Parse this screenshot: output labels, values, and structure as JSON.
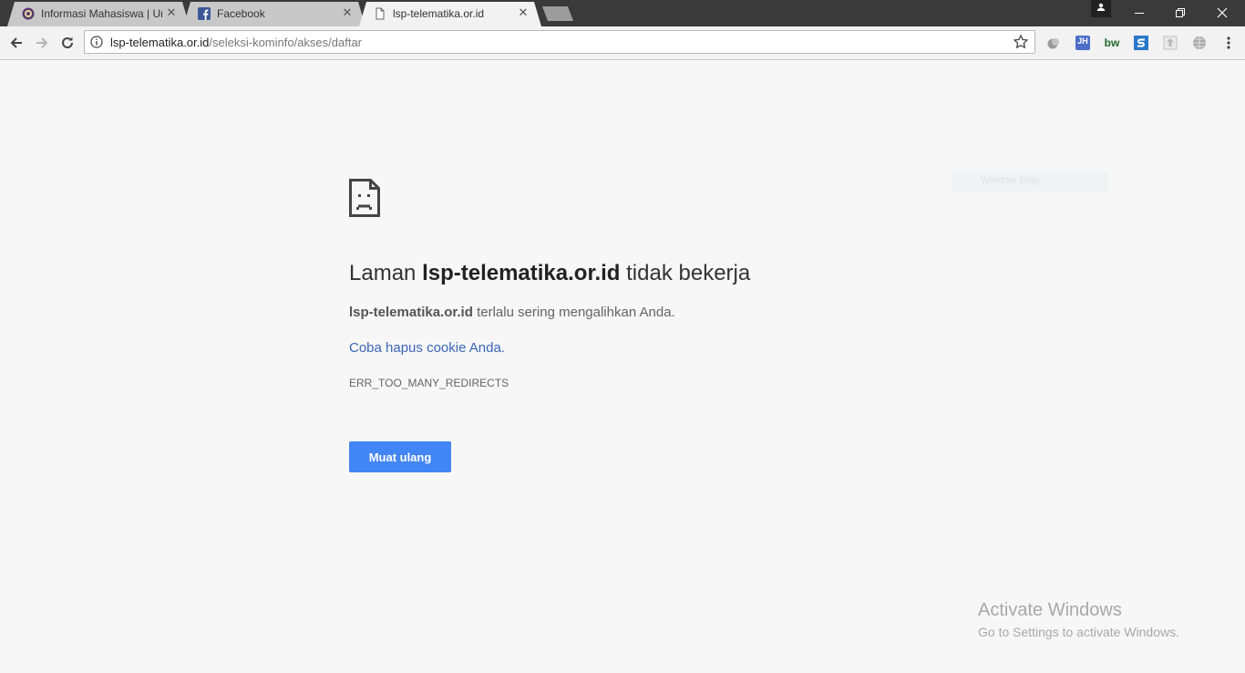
{
  "tabs": [
    {
      "title": "Informasi Mahasiswa | Ur",
      "favicon": "university-seal-icon",
      "active": false
    },
    {
      "title": "Facebook",
      "favicon": "facebook-icon",
      "active": false
    },
    {
      "title": "lsp-telematika.or.id",
      "favicon": "document-icon",
      "active": true
    }
  ],
  "toolbar": {
    "url_host": "lsp-telematika.or.id",
    "url_path": "/seleksi-kominfo/akses/daftar",
    "extensions": [
      "gray-extension-icon",
      "jh-extension-icon",
      "bw-extension-icon",
      "s-extension-icon",
      "upload-extension-icon",
      "globe-extension-icon"
    ],
    "ext_labels": {
      "jh": "JH",
      "bw": "bw"
    }
  },
  "error": {
    "heading_prefix": "Laman",
    "heading_host": "lsp-telematika.or.id",
    "heading_suffix": "tidak bekerja",
    "summary_host": "lsp-telematika.or.id",
    "summary_text": "terlalu sering mengalihkan Anda.",
    "suggestion": "Coba hapus cookie Anda.",
    "code": "ERR_TOO_MANY_REDIRECTS",
    "reload_label": "Muat ulang"
  },
  "overlay": {
    "faint_label": "Window Snip"
  },
  "watermark": {
    "line1": "Activate Windows",
    "line2": "Go to Settings to activate Windows."
  },
  "colors": {
    "accent": "#4285f4",
    "link": "#3b66b8",
    "page_bg": "#f7f7f7"
  }
}
